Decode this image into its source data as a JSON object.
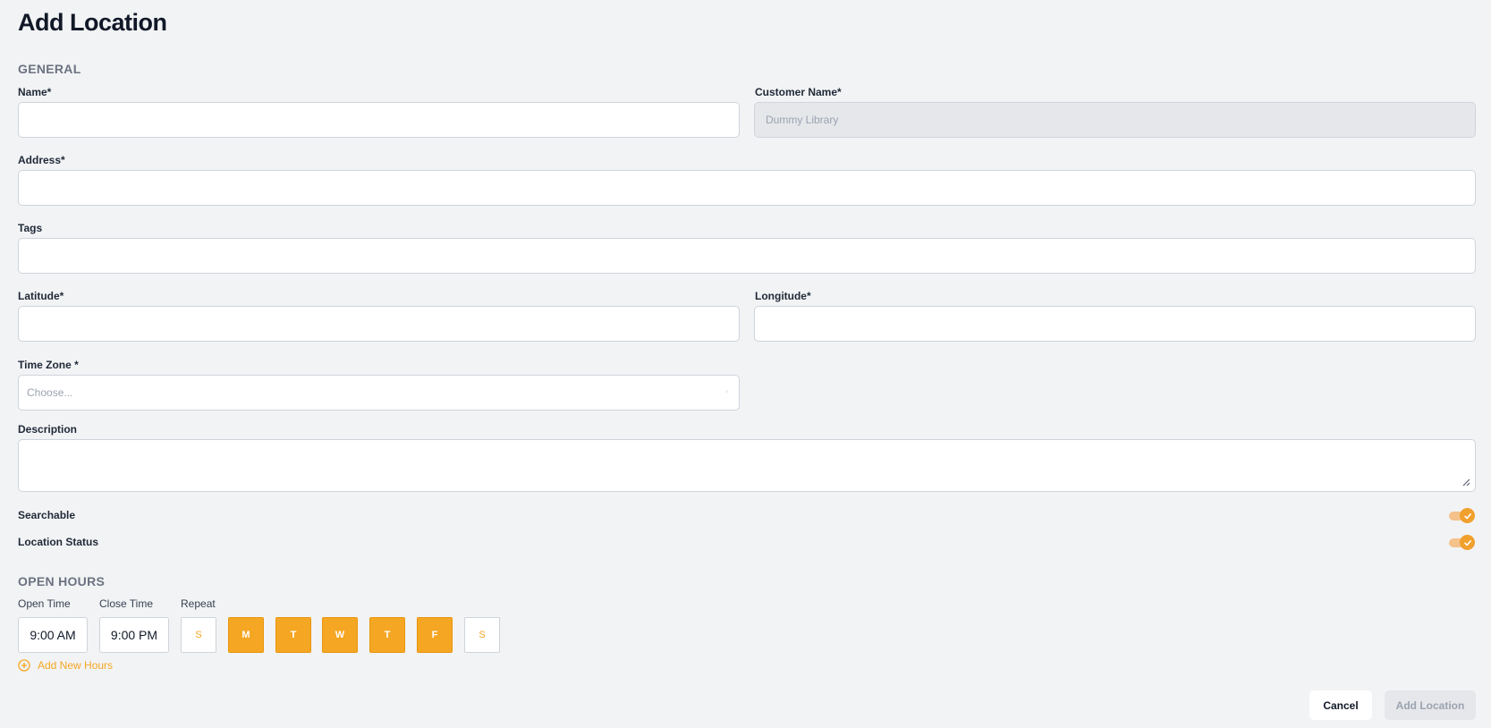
{
  "page_title": "Add Location",
  "general": {
    "title": "GENERAL",
    "name": {
      "label": "Name*",
      "value": ""
    },
    "customer_name": {
      "label": "Customer Name*",
      "value": "Dummy Library"
    },
    "address": {
      "label": "Address*",
      "value": ""
    },
    "tags": {
      "label": "Tags",
      "value": ""
    },
    "latitude": {
      "label": "Latitude*",
      "value": ""
    },
    "longitude": {
      "label": "Longitude*",
      "value": ""
    },
    "time_zone": {
      "label": "Time Zone *",
      "placeholder": "Choose..."
    },
    "description": {
      "label": "Description",
      "value": ""
    },
    "searchable": {
      "label": "Searchable",
      "on": true
    },
    "location_status": {
      "label": "Location Status",
      "on": true
    }
  },
  "open_hours": {
    "title": "OPEN HOURS",
    "open_time_label": "Open Time",
    "close_time_label": "Close Time",
    "repeat_label": "Repeat",
    "open_time": "9:00 AM",
    "close_time": "9:00 PM",
    "days": [
      {
        "letter": "S",
        "selected": false
      },
      {
        "letter": "M",
        "selected": true
      },
      {
        "letter": "T",
        "selected": true
      },
      {
        "letter": "W",
        "selected": true
      },
      {
        "letter": "T",
        "selected": true
      },
      {
        "letter": "F",
        "selected": true
      },
      {
        "letter": "S",
        "selected": false
      }
    ],
    "add_new_hours": "Add New Hours"
  },
  "actions": {
    "cancel": "Cancel",
    "submit": "Add Location"
  },
  "colors": {
    "accent": "#f5a623",
    "background": "#f2f3f5"
  }
}
